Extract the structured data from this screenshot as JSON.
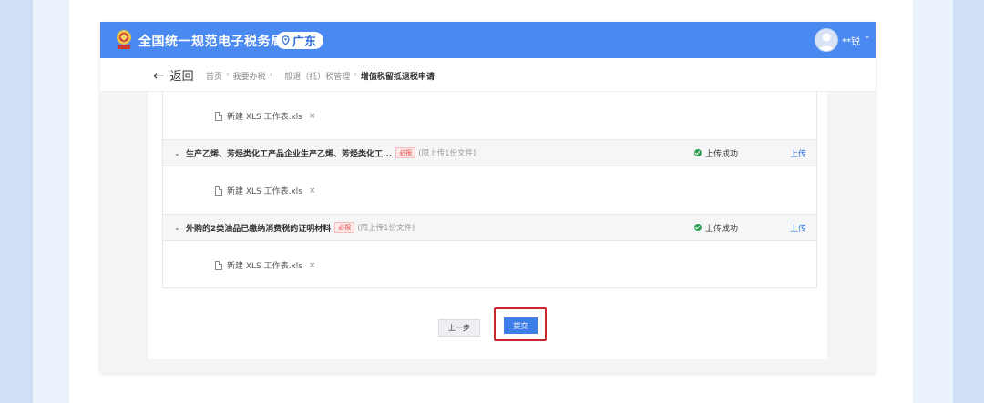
{
  "app": {
    "title": "全国统一规范电子税务局",
    "region": "广东",
    "user_name": "**锐"
  },
  "nav": {
    "back_label": "返回",
    "breadcrumbs": [
      "首页",
      "我要办税",
      "一般退（抵）税管理",
      "增值税留抵退税申请"
    ]
  },
  "attachments": {
    "first_file": {
      "name": "新建 XLS 工作表.xls"
    },
    "categories": [
      {
        "title": "生产乙烯、芳烃类化工产品企业生产乙烯、芳烃类化工...",
        "required_label": "必报",
        "limit_note": "(限上传1份文件)",
        "status": "上传成功",
        "upload_label": "上传",
        "file": "新建 XLS 工作表.xls"
      },
      {
        "title": "外购的2类油品已缴纳消费税的证明材料",
        "required_label": "必报",
        "limit_note": "(限上传1份文件)",
        "status": "上传成功",
        "upload_label": "上传",
        "file": "新建 XLS 工作表.xls"
      }
    ]
  },
  "actions": {
    "prev_label": "上一步",
    "submit_label": "提交"
  },
  "colors": {
    "header_blue": "#4a8af0",
    "primary_button": "#3d7fe6",
    "highlight_red": "#c8282d",
    "success_green": "#2e9d55",
    "required_red": "#e34b4b"
  }
}
